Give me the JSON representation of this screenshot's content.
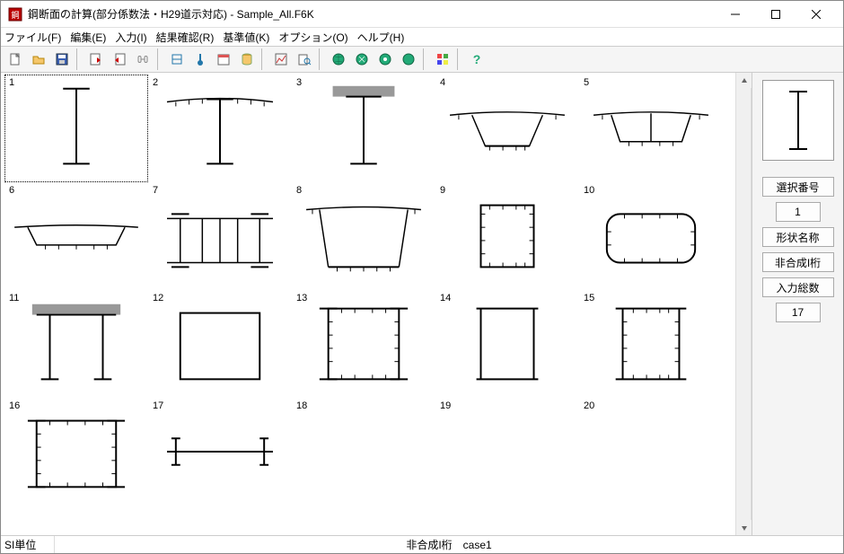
{
  "window": {
    "title": "鋼断面の計算(部分係数法・H29道示対応) - Sample_All.F6K"
  },
  "menu": {
    "file": "ファイル(F)",
    "edit": "編集(E)",
    "input": "入力(I)",
    "result": "結果確認(R)",
    "standard": "基準値(K)",
    "option": "オプション(O)",
    "help": "ヘルプ(H)"
  },
  "cells": {
    "n1": "1",
    "n2": "2",
    "n3": "3",
    "n4": "4",
    "n5": "5",
    "n6": "6",
    "n7": "7",
    "n8": "8",
    "n9": "9",
    "n10": "10",
    "n11": "11",
    "n12": "12",
    "n13": "13",
    "n14": "14",
    "n15": "15",
    "n16": "16",
    "n17": "17",
    "n18": "18",
    "n19": "19",
    "n20": "20"
  },
  "side": {
    "label_select": "選択番号",
    "value_select": "1",
    "label_shape": "形状名称",
    "value_shape": "非合成I桁",
    "label_count": "入力総数",
    "value_count": "17"
  },
  "status": {
    "unit": "SI単位",
    "center": "非合成I桁 case1"
  }
}
